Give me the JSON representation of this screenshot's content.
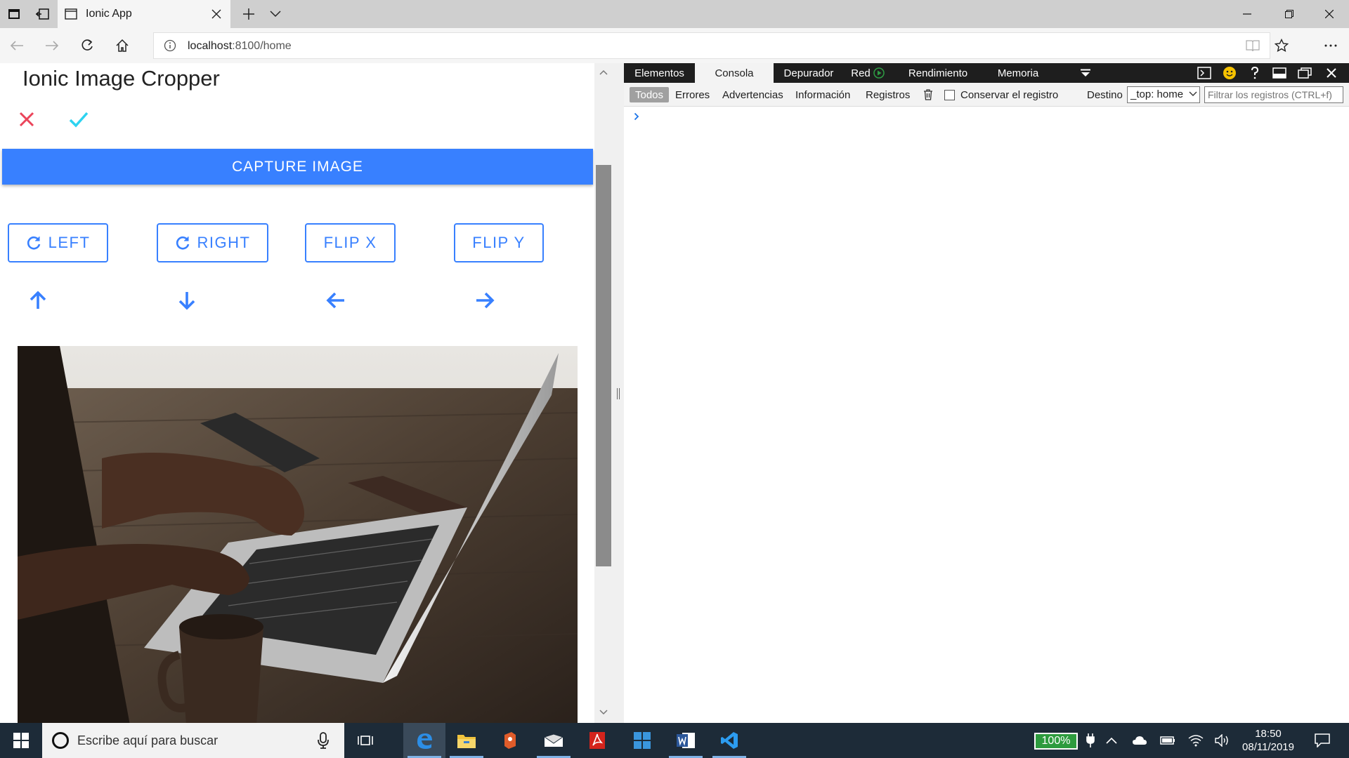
{
  "browser": {
    "tab_title": "Ionic App",
    "url_host": "localhost",
    "url_path": ":8100/home"
  },
  "app": {
    "title": "Ionic Image Cropper",
    "capture_label": "CAPTURE IMAGE",
    "tool_buttons": [
      {
        "label": "LEFT",
        "icon": "rotate-icon"
      },
      {
        "label": "RIGHT",
        "icon": "rotate-icon"
      },
      {
        "label": "FLIP X",
        "icon": ""
      },
      {
        "label": "FLIP Y",
        "icon": ""
      }
    ],
    "arrows": [
      "arrow-up-icon",
      "arrow-down-icon",
      "arrow-left-icon",
      "arrow-right-icon"
    ],
    "accent_color": "#3880ff",
    "cancel_color": "#eb445a",
    "confirm_color": "#2dd3f0"
  },
  "devtools": {
    "tabs": [
      "Elementos",
      "Consola",
      "Depurador",
      "Red",
      "Rendimiento",
      "Memoria"
    ],
    "active_tab": "Consola",
    "filters": [
      "Todos",
      "Errores",
      "Advertencias",
      "Información",
      "Registros"
    ],
    "active_filter": "Todos",
    "preserve_log_label": "Conservar el registro",
    "target_label": "Destino",
    "target_value": "_top: home",
    "filter_placeholder": "Filtrar los registros (CTRL+f)"
  },
  "taskbar": {
    "search_placeholder": "Escribe aquí para buscar",
    "battery": "100%",
    "time": "18:50",
    "date": "08/11/2019"
  }
}
